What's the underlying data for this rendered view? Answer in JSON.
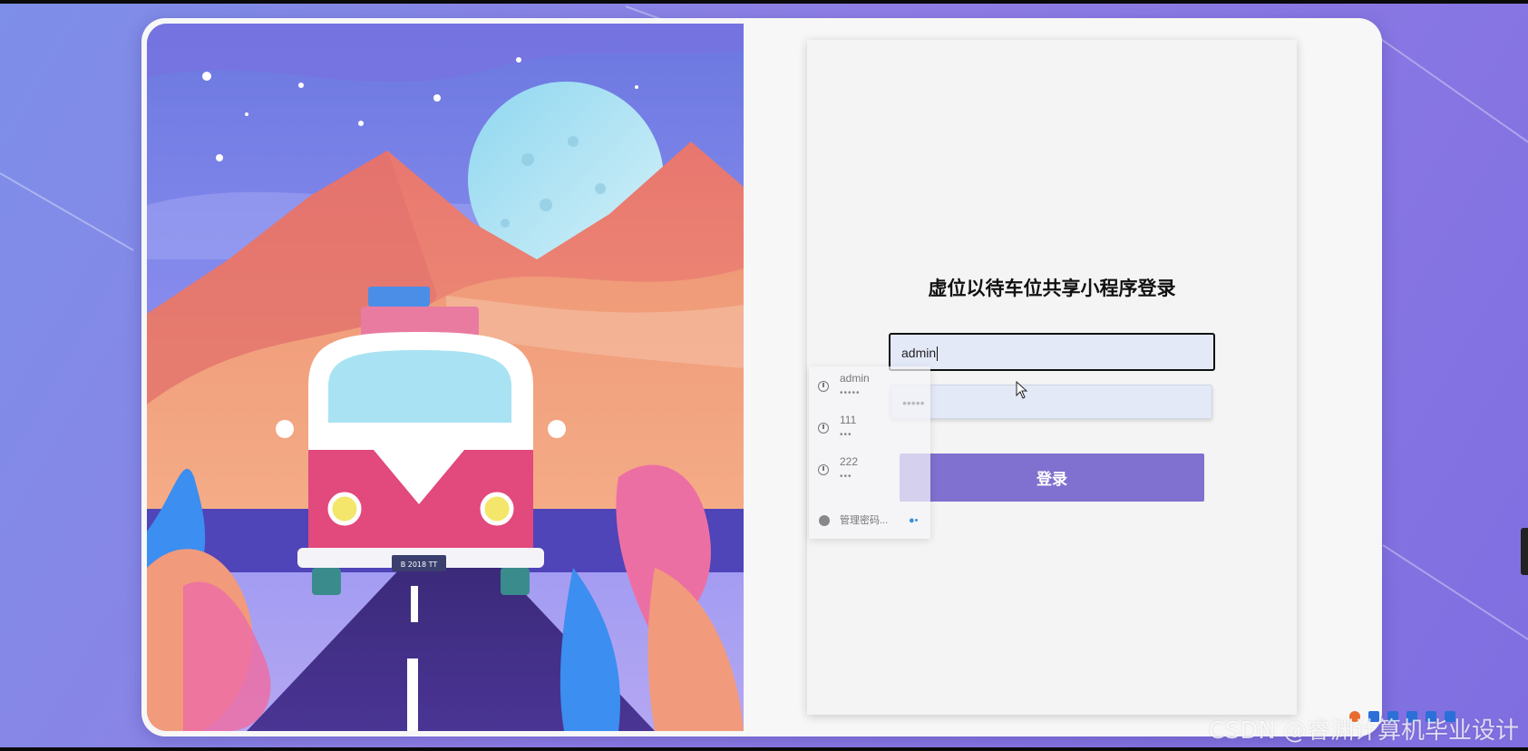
{
  "login": {
    "title": "虚位以待车位共享小程序登录",
    "username_value": "admin",
    "password_value": "•••••",
    "login_button": "登录"
  },
  "autofill": {
    "entries": [
      {
        "username": "admin",
        "password": "•••••"
      },
      {
        "username": "111",
        "password": "•••"
      },
      {
        "username": "222",
        "password": "•••"
      }
    ],
    "manage_label": "管理密码..."
  },
  "illustration": {
    "plate_text": "B 2018 TT"
  },
  "watermark": "CSDN @睿渊计算机毕业设计",
  "colors": {
    "background": "#8a7fe6",
    "login_button": "#8070cf",
    "input_fill": "#e3e9f7"
  }
}
